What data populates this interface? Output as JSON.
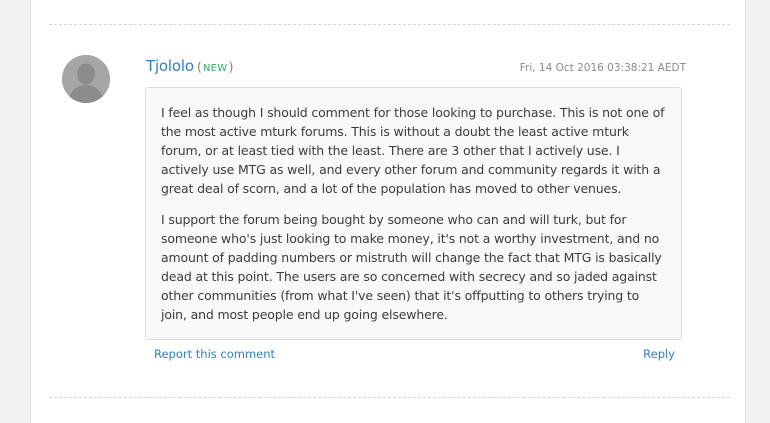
{
  "comment": {
    "author": "Tjololo",
    "badge_open": "(",
    "badge": "NEW",
    "badge_close": ")",
    "timestamp": "Fri, 14 Oct 2016 03:38:21 AEDT",
    "paragraphs": [
      "I feel as though I should comment for those looking to purchase. This is not one of the most active mturk forums. This is without a doubt the least active mturk forum, or at least tied with the least. There are 3 other that I actively use. I actively use MTG as well, and every other forum and community regards it with a great deal of scorn, and a lot of the population has moved to other venues.",
      "I support the forum being bought by someone who can and will turk, but for someone who's just looking to make money, it's not a worthy investment, and no amount of padding numbers or mistruth will change the fact that MTG is basically dead at this point. The users are so concerned with secrecy and so jaded against other communities (from what I've seen) that it's offputting to others trying to join, and most people end up going elsewhere."
    ],
    "report_label": "Report this comment",
    "reply_label": "Reply",
    "avatar_icon": "default-user-avatar-icon"
  },
  "colors": {
    "link": "#2f7fc8",
    "badge": "#2fb05e",
    "avatar": "#a6a6a6",
    "comment_bg": "#f9f9f9"
  }
}
